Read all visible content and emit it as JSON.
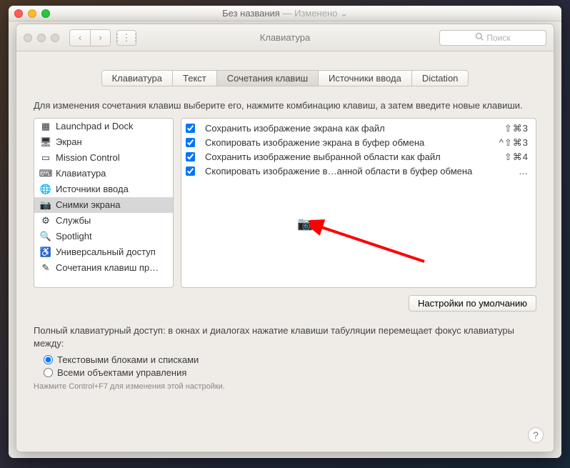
{
  "outer": {
    "title": "Без названия",
    "modified": "— Изменено"
  },
  "inner": {
    "title": "Клавиатура",
    "search_placeholder": "Поиск"
  },
  "tabs": [
    "Клавиатура",
    "Текст",
    "Сочетания клавиш",
    "Источники ввода",
    "Dictation"
  ],
  "tabs_selected": 2,
  "instruction": "Для изменения сочетания клавиш выберите его, нажмите комбинацию клавиш, а затем введите новые клавиши.",
  "sidebar": [
    {
      "icon": "launchpad",
      "label": "Launchpad и Dock"
    },
    {
      "icon": "display",
      "label": "Экран"
    },
    {
      "icon": "mission",
      "label": "Mission Control"
    },
    {
      "icon": "keyboard",
      "label": "Клавиатура"
    },
    {
      "icon": "input",
      "label": "Источники ввода"
    },
    {
      "icon": "camera",
      "label": "Снимки экрана"
    },
    {
      "icon": "services",
      "label": "Службы"
    },
    {
      "icon": "spotlight",
      "label": "Spotlight"
    },
    {
      "icon": "access",
      "label": "Универсальный доступ"
    },
    {
      "icon": "custom",
      "label": "Сочетания клавиш пр…"
    }
  ],
  "sidebar_selected": 5,
  "shortcuts": [
    {
      "checked": true,
      "label": "Сохранить изображение экрана как файл",
      "keys": "⇧⌘3"
    },
    {
      "checked": true,
      "label": "Скопировать изображение экрана в буфер обмена",
      "keys": "^⇧⌘3"
    },
    {
      "checked": true,
      "label": "Сохранить изображение выбранной области как файл",
      "keys": "⇧⌘4"
    },
    {
      "checked": true,
      "label": "Скопировать изображение в…анной области в буфер обмена",
      "keys": "…"
    }
  ],
  "defaults_btn": "Настройки по умолчанию",
  "kb_access": "Полный клавиатурный доступ: в окнах и диалогах нажатие клавиши табуляции перемещает фокус клавиатуры между:",
  "radios": [
    {
      "label": "Текстовыми блоками и списками",
      "checked": true
    },
    {
      "label": "Всеми объектами управления",
      "checked": false
    }
  ],
  "hint": "Нажмите Control+F7 для изменения этой настройки."
}
